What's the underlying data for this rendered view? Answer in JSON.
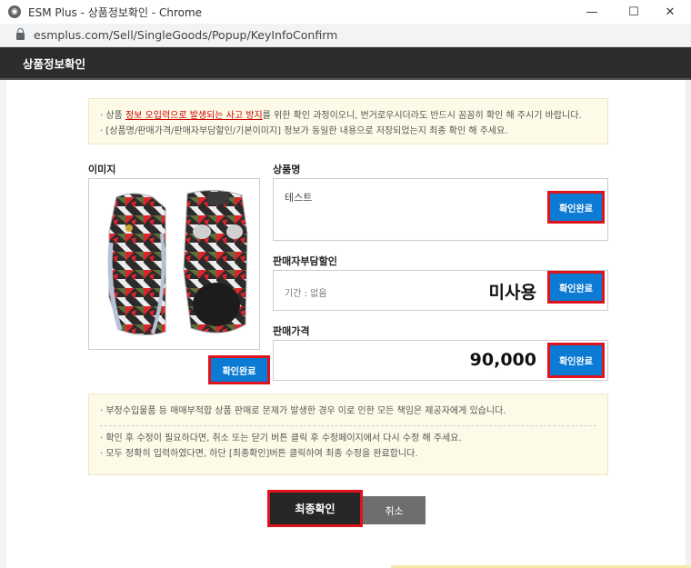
{
  "window": {
    "title": "ESM Plus - 상품정보확인 - Chrome",
    "url": "esmplus.com/Sell/SingleGoods/Popup/KeyInfoConfirm",
    "minimize": "—",
    "maximize": "☐",
    "close": "✕"
  },
  "popup": {
    "title": "상품정보확인"
  },
  "notice_top": {
    "line1_pre": "· 상품 ",
    "line1_red": "정보 오입력으로 발생되는 사고 방지",
    "line1_post": "를 위한 확인 과정이오니, 번거로우시더라도 반드시 꼼꼼히 확인 해 주시기 바랍니다.",
    "line2": "· [상품명/판매가격/판매자부담할인/기본이미지] 정보가 동일한 내용으로 저장되었는지 최종 확인 해 주세요."
  },
  "image_section": {
    "label": "이미지",
    "confirm_label": "확인완료"
  },
  "product_name": {
    "label": "상품명",
    "value": "테스트",
    "confirm_label": "확인완료"
  },
  "discount": {
    "label": "판매자부담할인",
    "period": "기간 : 없음",
    "value": "미사용",
    "confirm_label": "확인완료"
  },
  "price": {
    "label": "판매가격",
    "value": "90,000",
    "confirm_label": "확인완료"
  },
  "notice_bottom": {
    "line1": "· 부정수입물품 등 매매부적합 상품 판매로 문제가 발생한 경우 이로 인한 모든 책임은 제공자에게 있습니다.",
    "line2": "· 확인 후 수정이 필요하다면, 취소 또는 닫기 버튼 클릭 후 수정페이지에서 다시 수정 해 주세요.",
    "line3": "· 모두 정확히 입력하였다면, 하단 [최종확인]버튼 클릭하여 최종 수정을 완료합니다."
  },
  "actions": {
    "final_label": "최종확인",
    "cancel_label": "취소"
  }
}
